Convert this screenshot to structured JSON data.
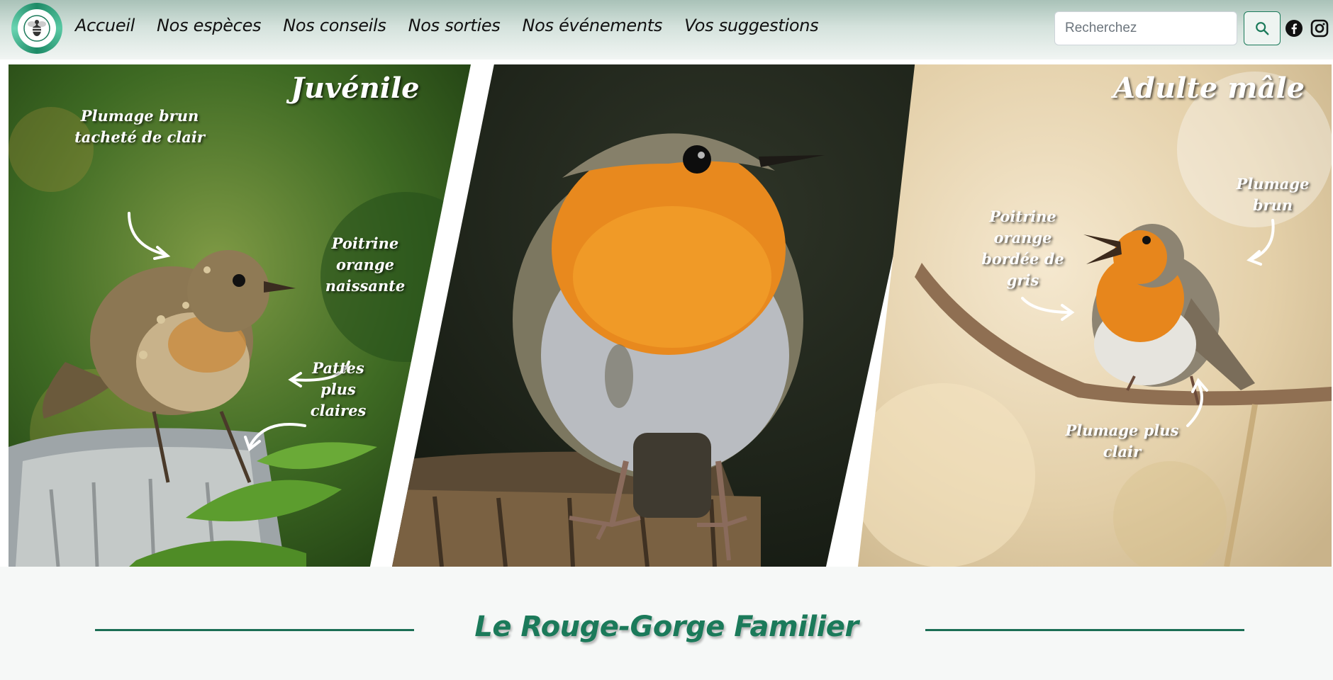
{
  "nav": {
    "links": [
      "Accueil",
      "Nos espèces",
      "Nos conseils",
      "Nos sorties",
      "Nos événements",
      "Vos suggestions"
    ]
  },
  "search": {
    "placeholder": "Recherchez"
  },
  "social": {
    "icons": [
      "facebook-icon",
      "instagram-icon"
    ]
  },
  "hero": {
    "left": {
      "title": "Juvénile",
      "labels": [
        "Plumage brun tacheté de clair",
        "Poitrine orange naissante",
        "Pattes plus claires"
      ]
    },
    "right": {
      "title": "Adulte mâle",
      "labels": [
        "Plumage brun",
        "Poitrine orange bordée de gris",
        "Plumage plus clair"
      ]
    }
  },
  "section": {
    "title": "Le Rouge-Gorge Familier"
  },
  "colors": {
    "accent": "#1b7a5a",
    "rule": "#1b6e55"
  }
}
